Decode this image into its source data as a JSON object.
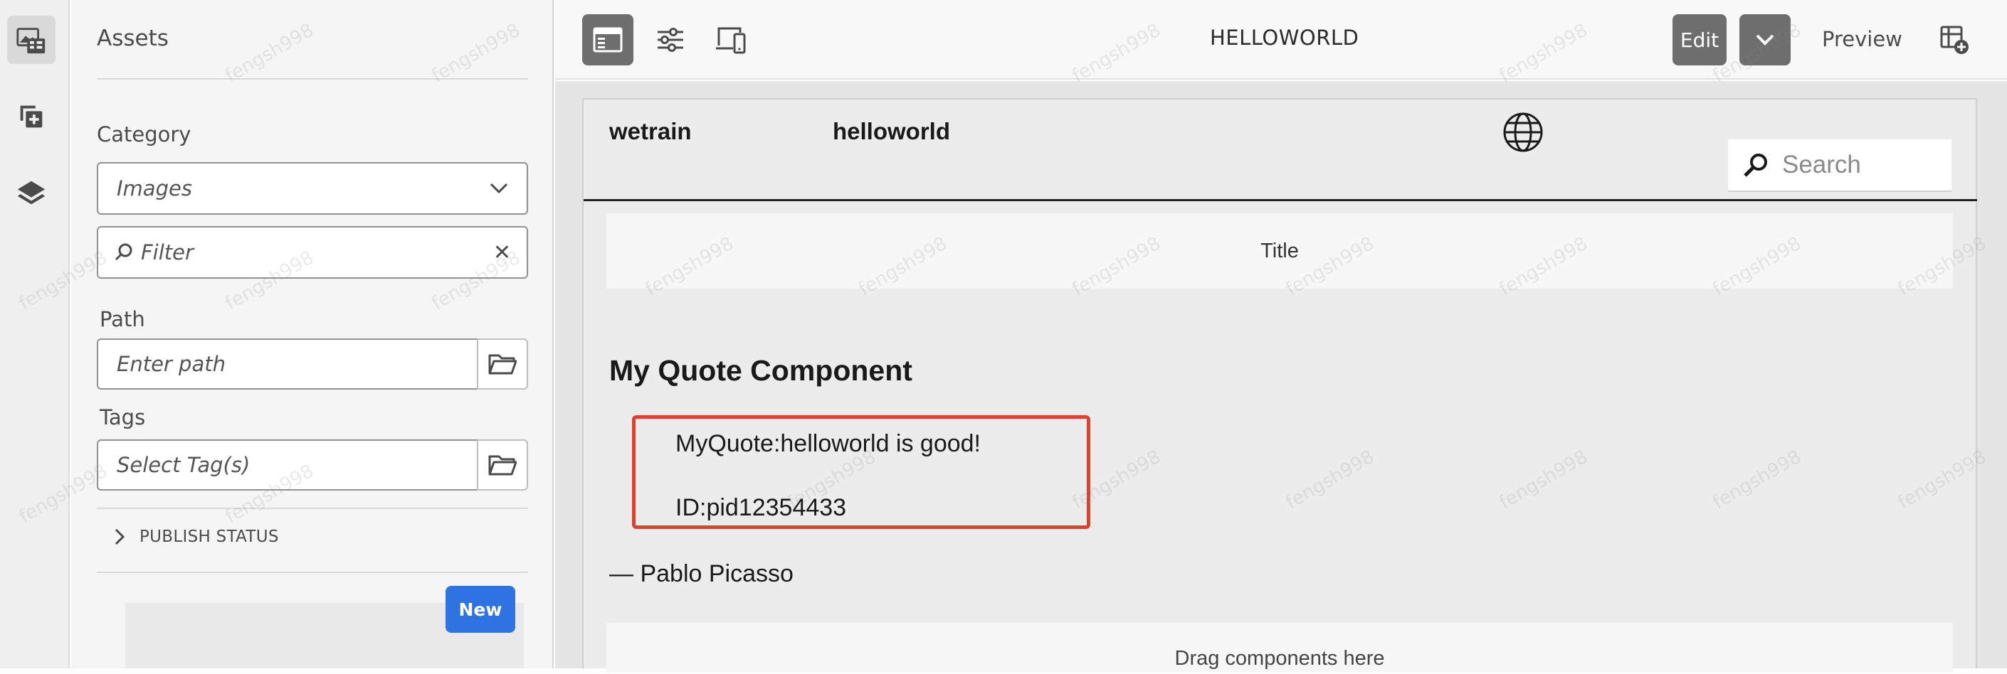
{
  "rail": {
    "items": [
      {
        "icon": "assets-icon",
        "active": true
      },
      {
        "icon": "components-icon",
        "active": false
      },
      {
        "icon": "layers-icon",
        "active": false
      }
    ]
  },
  "panel": {
    "title": "Assets",
    "category_label": "Category",
    "category_value": "Images",
    "filter_placeholder": "Filter",
    "path_label": "Path",
    "path_placeholder": "Enter path",
    "tags_label": "Tags",
    "tags_placeholder": "Select Tag(s)",
    "publish_status": "PUBLISH STATUS",
    "new_button": "New"
  },
  "toolbar": {
    "page_title": "HELLOWORLD",
    "edit_label": "Edit",
    "preview_label": "Preview"
  },
  "site": {
    "brand": "wetrain",
    "nav_item": "helloworld",
    "search_placeholder": "Search",
    "title_component": "Title",
    "component_heading": "My Quote Component",
    "quote_text": "MyQuote:helloworld is good!",
    "quote_id": "ID:pid12354433",
    "author": "— Pablo Picasso",
    "drop_zone_text": "Drag components here"
  },
  "watermark": "fengsh998",
  "colors": {
    "accent_blue": "#2f72e2",
    "highlight_red": "#e0412f",
    "toolbar_active": "#6e6e6e"
  }
}
